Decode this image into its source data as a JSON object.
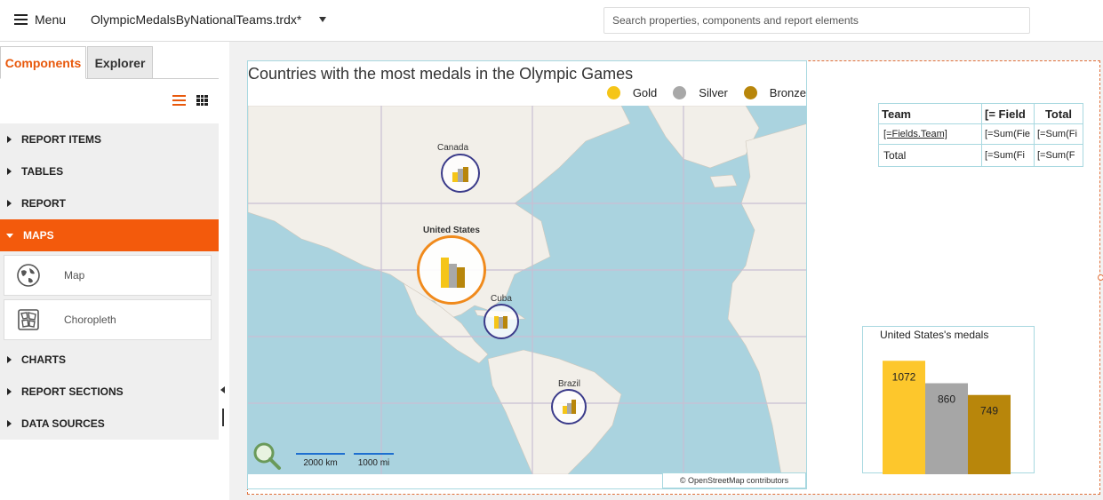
{
  "topbar": {
    "menu_label": "Menu",
    "file_name": "OlympicMedalsByNationalTeams.trdx*",
    "search_placeholder": "Search properties, components and report elements"
  },
  "panel": {
    "tabs": [
      {
        "label": "Components",
        "active": true
      },
      {
        "label": "Explorer",
        "active": false
      }
    ],
    "categories": [
      {
        "label": "REPORT ITEMS"
      },
      {
        "label": "TABLES"
      },
      {
        "label": "REPORT"
      },
      {
        "label": "MAPS",
        "expanded": true
      },
      {
        "label": "CHARTS"
      },
      {
        "label": "REPORT SECTIONS"
      },
      {
        "label": "DATA SOURCES"
      }
    ],
    "map_components": [
      {
        "label": "Map",
        "icon": "globe-icon"
      },
      {
        "label": "Choropleth",
        "icon": "choropleth-icon"
      }
    ]
  },
  "map": {
    "title": "Countries with the most medals in the Olympic Games",
    "legend": [
      {
        "label": "Gold",
        "color": "#f5c518"
      },
      {
        "label": "Silver",
        "color": "#a8a8a8"
      },
      {
        "label": "Bronze",
        "color": "#b8860b"
      }
    ],
    "markers": [
      {
        "label": "Canada"
      },
      {
        "label": "United States"
      },
      {
        "label": "Cuba"
      },
      {
        "label": "Brazil"
      }
    ],
    "scale_km": "2000 km",
    "scale_mi": "1000 mi",
    "attribution": "© OpenStreetMap contributors"
  },
  "crosstab": {
    "headers": [
      "Team",
      "[= Field",
      "Total"
    ],
    "row": [
      "[=Fields.Team]",
      "[=Sum(Fie",
      "[=Sum(Fi"
    ],
    "total_row": [
      "Total",
      "[=Sum(Fi",
      "[=Sum(F"
    ]
  },
  "chart_data": {
    "type": "bar",
    "title": "United States's medals",
    "categories": [
      "Gold",
      "Silver",
      "Bronze"
    ],
    "values": [
      1072,
      860,
      749
    ],
    "colors": [
      "#fdc72c",
      "#a6a6a6",
      "#b8860b"
    ],
    "ylim": [
      0,
      1200
    ]
  }
}
